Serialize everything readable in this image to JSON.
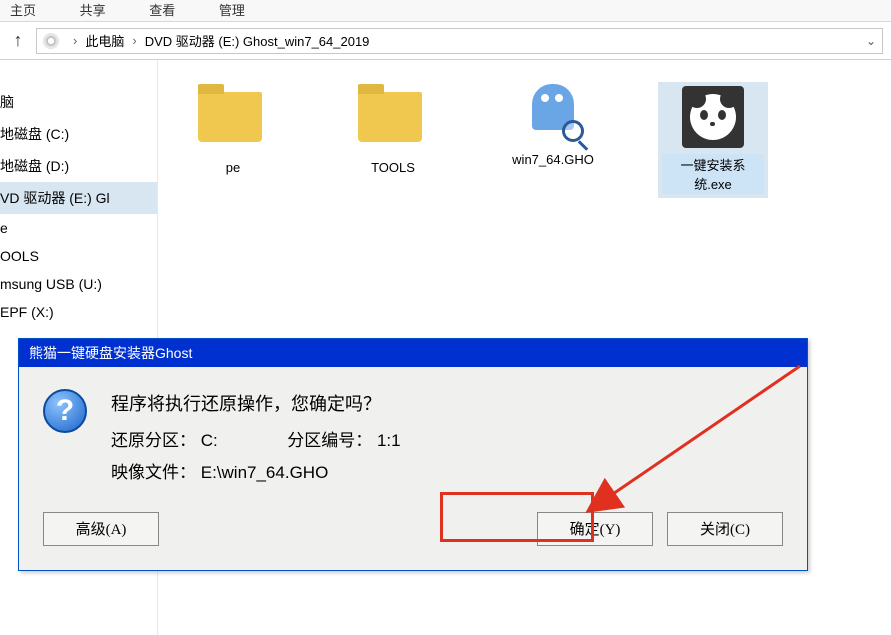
{
  "menubar": {
    "item1": "主页",
    "item2": "共享",
    "item3": "查看",
    "item4": "管理"
  },
  "breadcrumb": {
    "root": "此电脑",
    "drive": "DVD 驱动器 (E:) Ghost_win7_64_2019"
  },
  "sidebar": {
    "items": [
      "脑",
      "地磁盘 (C:)",
      "地磁盘 (D:)",
      "VD 驱动器 (E:) Gl",
      "e",
      "OOLS",
      "msung USB (U:)",
      "EPF (X:)"
    ]
  },
  "files": [
    {
      "name": "pe",
      "type": "folder"
    },
    {
      "name": "TOOLS",
      "type": "folder"
    },
    {
      "name": "win7_64.GHO",
      "type": "gho"
    },
    {
      "name": "一键安装系统.exe",
      "type": "exe"
    }
  ],
  "dialog": {
    "title": "熊猫一键硬盘安装器Ghost",
    "prompt": "程序将执行还原操作，您确定吗？",
    "partition_label": "还原分区：",
    "partition_value": "C:",
    "partnum_label": "分区编号：",
    "partnum_value": "1:1",
    "image_label": "映像文件：",
    "image_value": "E:\\win7_64.GHO",
    "btn_advanced": "高级(A)",
    "btn_ok": "确定(Y)",
    "btn_close": "关闭(C)"
  }
}
